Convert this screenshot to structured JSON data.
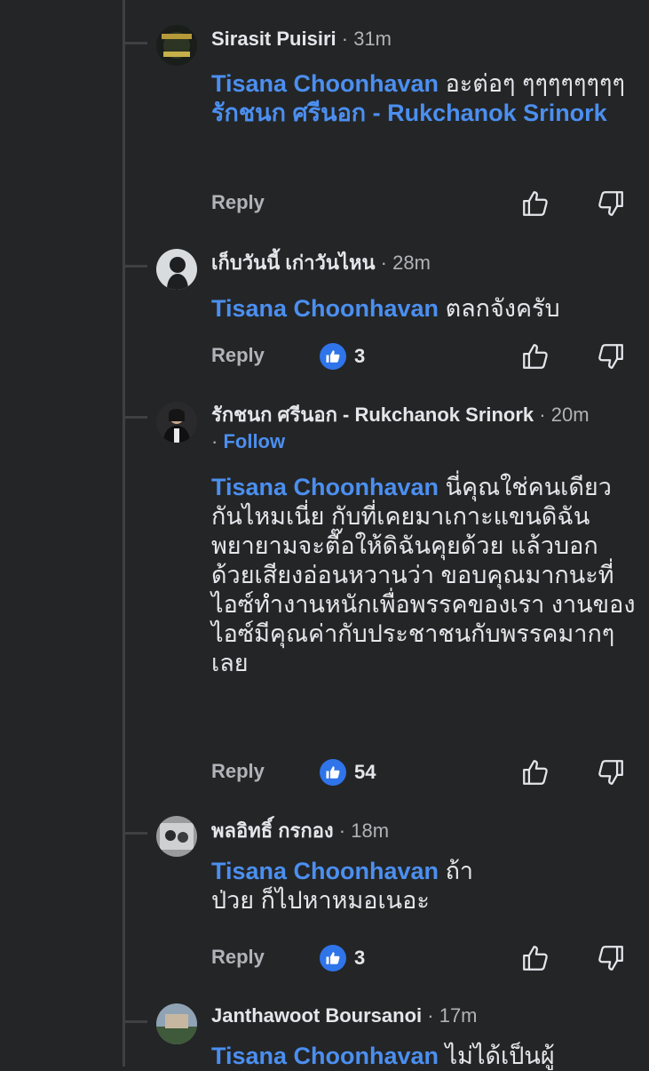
{
  "comments": [
    {
      "author": "Sirasit Puisiri",
      "time": "31m",
      "body": [
        {
          "type": "mention",
          "text": "Tisana Choonhavan"
        },
        {
          "type": "text",
          "text": " อะต่อๆ ๆๆๆๆๆๆๆๆ "
        },
        {
          "type": "mention",
          "text": "รักชนก ศรีนอก - Rukchanok Srinork"
        }
      ],
      "reply_label": "Reply",
      "reaction_count": ""
    },
    {
      "author": "เก็บวันนี้ เก่าวันไหน",
      "time": "28m",
      "body": [
        {
          "type": "mention",
          "text": "Tisana Choonhavan"
        },
        {
          "type": "text",
          "text": " ตลกจังครับ"
        }
      ],
      "reply_label": "Reply",
      "reaction_count": "3"
    },
    {
      "author": "รักชนก ศรีนอก - Rukchanok Srinork",
      "time": "20m",
      "follow": "Follow",
      "body": [
        {
          "type": "mention",
          "text": "Tisana Choonhavan"
        },
        {
          "type": "text",
          "text": " นี่คุณใช่คนเดียวกันไหมเนี่ย กับที่เคยมาเกาะแขนดิฉัน พยายามจะตื๊อให้ดิฉันคุยด้วย แล้วบอกด้วยเสียงอ่อนหวานว่า ขอบคุณมากนะที่ไอซ์ทำงานหนักเพื่อพรรคของเรา งานของไอซ์มีคุณค่ากับประชาชนกับพรรคมากๆเลย"
        }
      ],
      "reply_label": "Reply",
      "reaction_count": "54"
    },
    {
      "author": "พลอิทธิ์ กรกอง",
      "time": "18m",
      "body": [
        {
          "type": "mention",
          "text": "Tisana Choonhavan"
        },
        {
          "type": "text",
          "text": " ถ้าป่วย ก็ไปหาหมอเนอะ"
        }
      ],
      "reply_label": "Reply",
      "reaction_count": "3"
    },
    {
      "author": "Janthawoot Boursanoi",
      "time": "17m",
      "body": [
        {
          "type": "mention",
          "text": "Tisana Choonhavan"
        },
        {
          "type": "text",
          "text": " ไม่ได้เป็นผู้"
        }
      ],
      "reply_label": "",
      "reaction_count": ""
    }
  ],
  "colors": {
    "background": "#242526",
    "link": "#4b8ff0",
    "like": "#2f74e9",
    "muted": "#b0b3b8"
  },
  "icons": [
    "like-icon",
    "thumbs-up-icon",
    "thumbs-down-icon"
  ]
}
